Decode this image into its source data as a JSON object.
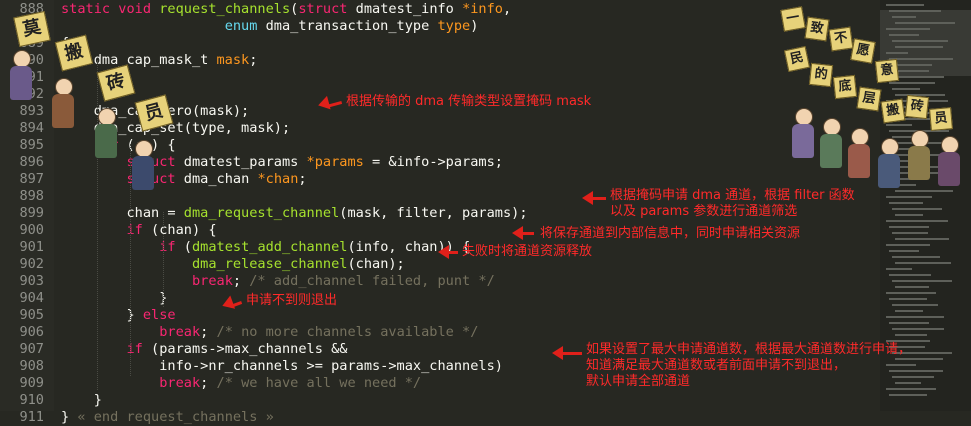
{
  "code": {
    "lines": [
      {
        "n": "888",
        "segs": [
          [
            "kw",
            "static "
          ],
          [
            "kw",
            "void "
          ],
          [
            "fn",
            "request_channels"
          ],
          [
            "tx",
            "("
          ],
          [
            "kw",
            "struct "
          ],
          [
            "tx",
            "dmatest_info "
          ],
          [
            "pa",
            "*info"
          ],
          [
            "tx",
            ","
          ]
        ]
      },
      {
        "n": "",
        "segs": [
          [
            "tx",
            "                    "
          ],
          [
            "ty",
            "enum "
          ],
          [
            "tx",
            "dma_transaction_type "
          ],
          [
            "pa",
            "type"
          ],
          [
            "tx",
            ")"
          ]
        ]
      },
      {
        "n": "889",
        "segs": [
          [
            "tx",
            "{"
          ]
        ]
      },
      {
        "n": "890",
        "segs": [
          [
            "tx",
            "    dma_cap_mask_t "
          ],
          [
            "pa",
            "mask"
          ],
          [
            "tx",
            ";"
          ]
        ]
      },
      {
        "n": "891",
        "segs": []
      },
      {
        "n": "892",
        "segs": []
      },
      {
        "n": "893",
        "segs": [
          [
            "tx",
            "    dma_cap_zero(mask);"
          ]
        ]
      },
      {
        "n": "894",
        "segs": [
          [
            "tx",
            "    dma_cap_set(type, mask);"
          ]
        ]
      },
      {
        "n": "895",
        "segs": [
          [
            "tx",
            "    "
          ],
          [
            "kw",
            "for "
          ],
          [
            "tx",
            "(;;) {"
          ]
        ]
      },
      {
        "n": "896",
        "segs": [
          [
            "tx",
            "        "
          ],
          [
            "kw",
            "struct "
          ],
          [
            "tx",
            "dmatest_params "
          ],
          [
            "pa",
            "*params"
          ],
          [
            "tx",
            " = &info->params;"
          ]
        ]
      },
      {
        "n": "897",
        "segs": [
          [
            "tx",
            "        "
          ],
          [
            "kw",
            "struct "
          ],
          [
            "tx",
            "dma_chan "
          ],
          [
            "pa",
            "*chan"
          ],
          [
            "tx",
            ";"
          ]
        ]
      },
      {
        "n": "898",
        "segs": []
      },
      {
        "n": "899",
        "segs": [
          [
            "tx",
            "        chan = "
          ],
          [
            "fn",
            "dma_request_channel"
          ],
          [
            "tx",
            "(mask, filter, params);"
          ]
        ]
      },
      {
        "n": "900",
        "segs": [
          [
            "tx",
            "        "
          ],
          [
            "kw",
            "if "
          ],
          [
            "tx",
            "(chan) {"
          ]
        ]
      },
      {
        "n": "901",
        "segs": [
          [
            "tx",
            "            "
          ],
          [
            "kw",
            "if "
          ],
          [
            "tx",
            "("
          ],
          [
            "fn",
            "dmatest_add_channel"
          ],
          [
            "tx",
            "(info, chan)) {"
          ]
        ]
      },
      {
        "n": "902",
        "segs": [
          [
            "tx",
            "                "
          ],
          [
            "fn",
            "dma_release_channel"
          ],
          [
            "tx",
            "(chan);"
          ]
        ]
      },
      {
        "n": "903",
        "segs": [
          [
            "tx",
            "                "
          ],
          [
            "kw",
            "break"
          ],
          [
            "tx",
            "; "
          ],
          [
            "cm",
            "/* add_channel failed, punt */"
          ]
        ]
      },
      {
        "n": "904",
        "segs": [
          [
            "tx",
            "            }"
          ]
        ]
      },
      {
        "n": "905",
        "segs": [
          [
            "tx",
            "        } "
          ],
          [
            "kw",
            "else"
          ]
        ]
      },
      {
        "n": "906",
        "segs": [
          [
            "tx",
            "            "
          ],
          [
            "kw",
            "break"
          ],
          [
            "tx",
            "; "
          ],
          [
            "cm",
            "/* no more channels available */"
          ]
        ]
      },
      {
        "n": "907",
        "segs": [
          [
            "tx",
            "        "
          ],
          [
            "kw",
            "if "
          ],
          [
            "tx",
            "(params->max_channels &&"
          ]
        ]
      },
      {
        "n": "908",
        "segs": [
          [
            "tx",
            "            info->nr_channels >= params->max_channels)"
          ]
        ]
      },
      {
        "n": "909",
        "segs": [
          [
            "tx",
            "            "
          ],
          [
            "kw",
            "break"
          ],
          [
            "tx",
            "; "
          ],
          [
            "cm",
            "/* we have all we need */"
          ]
        ]
      },
      {
        "n": "910",
        "segs": [
          [
            "tx",
            "    }"
          ]
        ]
      },
      {
        "n": "911",
        "segs": [
          [
            "tx",
            "} "
          ],
          [
            "cm",
            "« end request_channels »"
          ]
        ]
      }
    ]
  },
  "annotations": {
    "a1": "根据传输的 dma 传输类型设置掩码 mask",
    "a2": "根据掩码申请 dma 通道，根据 filter 函数\n以及 params 参数进行通道筛选",
    "a3": "将保存通道到内部信息中，同时申请相关资源",
    "a4": "失败时将通道资源释放",
    "a5": "申请不到则退出",
    "a6": "如果设置了最大申请通道数，根据最大通道数进行申请，\n知道满足最大通道数或者前面申请不到退出，\n默认申请全部通道"
  },
  "signs": {
    "left": [
      "莫",
      "搬",
      "砖",
      "员"
    ],
    "right": [
      "一",
      "致",
      "不",
      "愿",
      "意",
      "民",
      "的",
      "底",
      "层",
      "搬",
      "砖",
      "员"
    ]
  },
  "colors": {
    "background": "#272822",
    "keyword": "#f92672",
    "type": "#66d9ef",
    "function": "#a6e22e",
    "param": "#fd971f",
    "comment": "#75715e",
    "annotation": "#ff2a2a"
  }
}
